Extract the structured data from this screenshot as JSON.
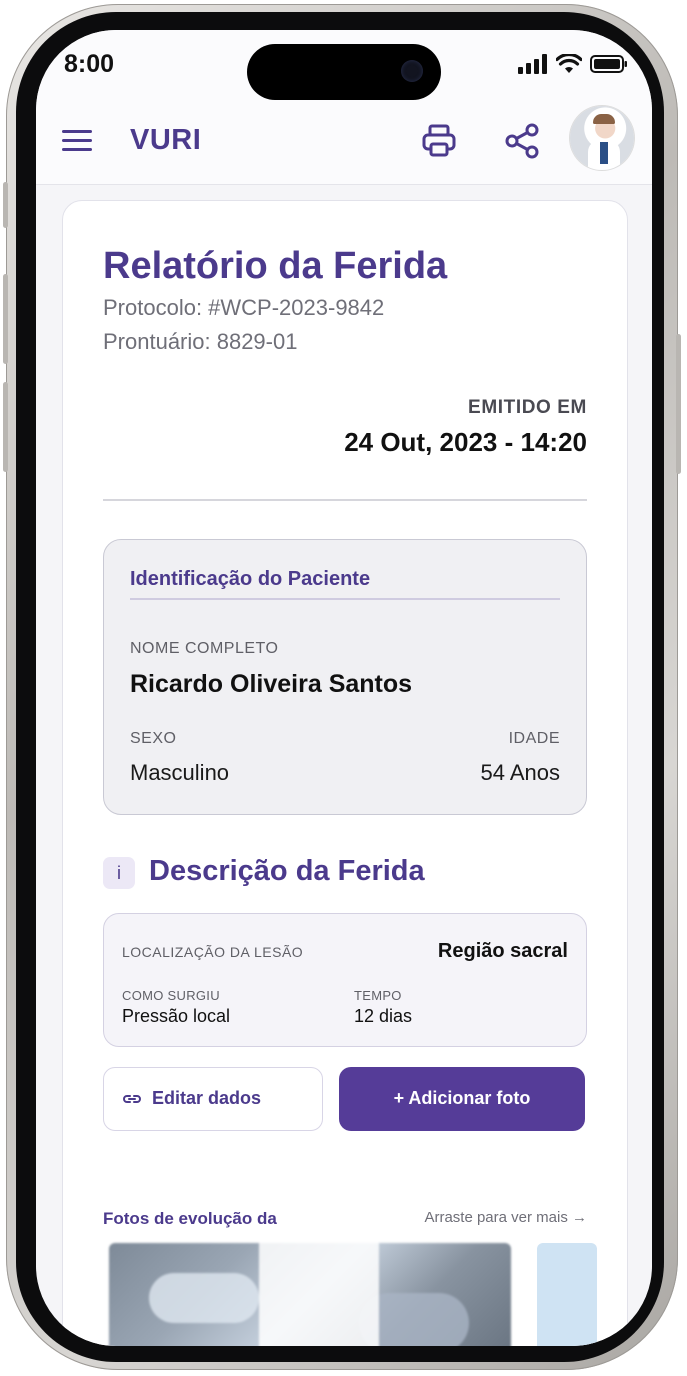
{
  "status_bar": {
    "time": "8:00"
  },
  "app_bar": {
    "brand": "VURI"
  },
  "report": {
    "title": "Relatório da Ferida",
    "protocolo": "Protocolo: #WCP-2023-9842",
    "prontuario": "Prontuário: 8829-01",
    "emitido_label": "EMITIDO EM",
    "emitido_data": "24 Out, 2023 - 14:20"
  },
  "patient": {
    "section_title": "Identificação do Paciente",
    "name_label": "NOME COMPLETO",
    "name": "Ricardo Oliveira Santos",
    "sexo_label": "SEXO",
    "sexo": "Masculino",
    "idade_label": "IDADE",
    "idade": "54 Anos"
  },
  "wound": {
    "badge": "i",
    "section_title": "Descrição da Ferida",
    "localizacao_label": "LOCALIZAÇÃO DA LESÃO",
    "localizacao": "Região sacral",
    "como_label": "COMO SURGIU",
    "como": "Pressão local",
    "tempo_label": "TEMPO",
    "tempo": "12 dias"
  },
  "actions": {
    "edit_label": "Editar dados",
    "add_label": "+  Adicionar foto"
  },
  "photos": {
    "title": "Fotos de evolução da",
    "hint": "Arraste para ver mais →"
  },
  "colors": {
    "brand": "#4b3a8c",
    "primary_button": "#553c98"
  }
}
